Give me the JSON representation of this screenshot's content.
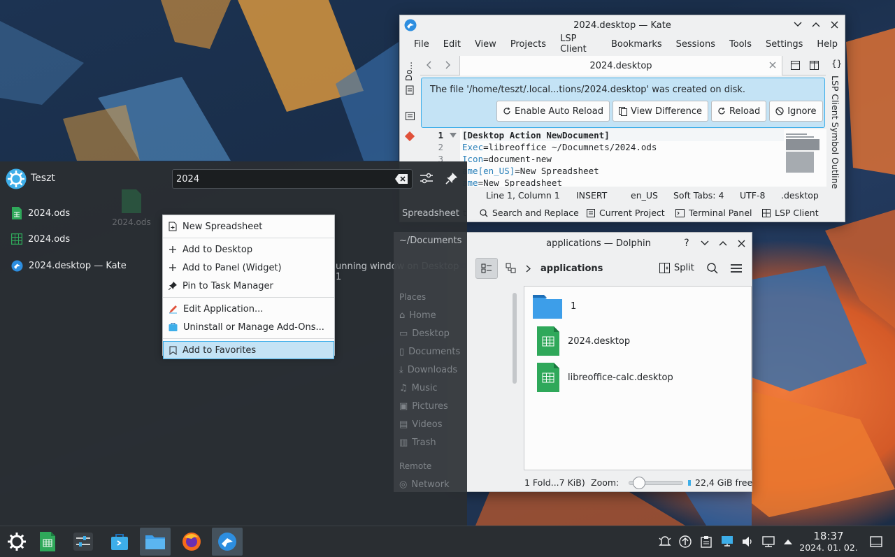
{
  "kate": {
    "title": "2024.desktop — Kate",
    "menu": [
      "File",
      "Edit",
      "View",
      "Projects",
      "LSP Client",
      "Bookmarks",
      "Sessions",
      "Tools",
      "Settings",
      "Help"
    ],
    "tab_label": "2024.desktop",
    "left_panel_label": "Do...",
    "right_panel_label": "LSP Client Symbol Outline",
    "notice": "The file '/home/teszt/.local...tions/2024.desktop' was created on disk.",
    "notice_buttons": [
      "Enable Auto Reload",
      "View Difference",
      "Reload",
      "Ignore"
    ],
    "lines": [
      {
        "n": "1",
        "text": "[Desktop Action NewDocument]"
      },
      {
        "n": "2",
        "key": "Exec",
        "text": "=libreoffice ~/Documnets/2024.ods"
      },
      {
        "n": "3",
        "key": "Icon",
        "text": "=document-new"
      },
      {
        "n": "",
        "key": "ame[en_US]",
        "text": "=New Spreadsheet"
      },
      {
        "n": "",
        "key": "ame",
        "text": "=New Spreadsheet"
      }
    ],
    "status": [
      "Line 1, Column 1",
      "INSERT",
      "en_US",
      "Soft Tabs: 4",
      "UTF-8",
      ".desktop"
    ],
    "bottom_tools": [
      "t",
      "Search and Replace",
      "Current Project",
      "Terminal Panel",
      "LSP Client"
    ]
  },
  "launcher": {
    "user": "Teszt",
    "search_value": "2024",
    "category_label": "Spreadsheet",
    "documents_label": "~/Documents",
    "results": [
      "2024.ods",
      "2024.ods",
      "2024.desktop — Kate"
    ],
    "ghost_label": "2024.ods",
    "running_hint": "unning window on Desktop 1",
    "places": [
      "Places",
      "Home",
      "Desktop",
      "Documents",
      "Downloads",
      "Music",
      "Pictures",
      "Videos",
      "Trash",
      "Remote",
      "Network"
    ]
  },
  "context_menu": {
    "items": [
      "New Spreadsheet",
      "Add to Desktop",
      "Add to Panel (Widget)",
      "Pin to Task Manager",
      "Edit Application...",
      "Uninstall or Manage Add-Ons...",
      "Add to Favorites"
    ]
  },
  "dolphin": {
    "title": "applications — Dolphin",
    "breadcrumb": "applications",
    "split_label": "Split",
    "files": [
      "1",
      "2024.desktop",
      "libreoffice-calc.desktop"
    ],
    "status_left": "1 Fold...7 KiB)",
    "zoom_label": "Zoom:",
    "free_space": "22,4 GiB free",
    "zoom_level": 0.12
  },
  "taskbar": {
    "time": "18:37",
    "date": "2024. 01. 02."
  },
  "colors": {
    "accent": "#3daee9",
    "selection": "#c4e3f5",
    "calc_green": "#2fa85a",
    "folder_blue": "#3d9ee9"
  }
}
